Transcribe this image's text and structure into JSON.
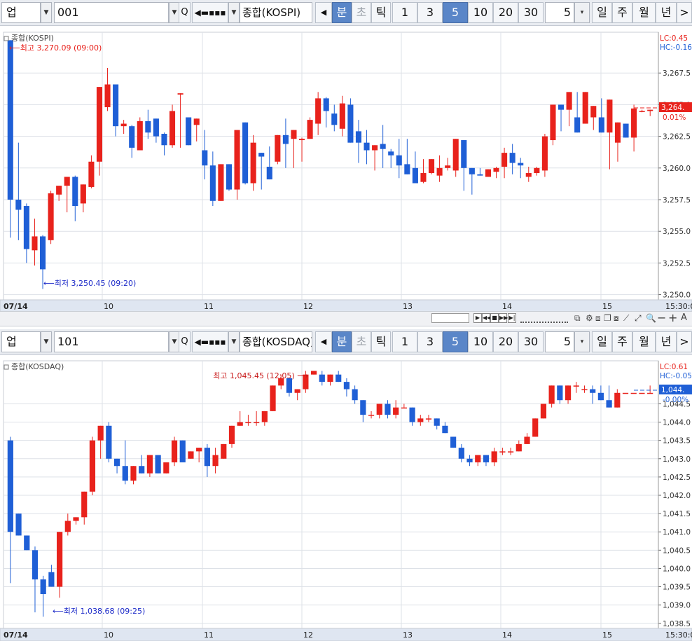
{
  "toolbar1": {
    "type_label": "업",
    "code": "001",
    "name": "종합(KOSPI)",
    "period_tabs": [
      "분",
      "초",
      "틱"
    ],
    "intervals": [
      "1",
      "3",
      "5",
      "10",
      "20",
      "30"
    ],
    "active_interval": "5",
    "count_value": "5",
    "range_tabs": [
      "일",
      "주",
      "월",
      "년"
    ]
  },
  "toolbar2": {
    "type_label": "업",
    "code": "101",
    "name": "종합(KOSDAQ)",
    "period_tabs": [
      "분",
      "초",
      "틱"
    ],
    "intervals": [
      "1",
      "3",
      "5",
      "10",
      "20",
      "30"
    ],
    "active_interval": "5",
    "count_value": "5",
    "range_tabs": [
      "일",
      "주",
      "월",
      "년"
    ]
  },
  "chart1": {
    "title": "종합(KOSPI)",
    "high_label": "최고 3,270.09 (09:00)",
    "low_label": "최저 3,250.45 (09:20)",
    "lc_label": "LC:0.45",
    "hc_label": "HC:-0.16",
    "current_price": "3,264.",
    "current_change": "0.01%"
  },
  "chart2": {
    "title": "종합(KOSDAQ)",
    "high_label": "최고 1,045.45 (12:05)",
    "low_label": "최저 1,038.68 (09:25)",
    "lc_label": "LC:0.61",
    "hc_label": "HC:-0.05",
    "current_price": "1,044.",
    "current_change": "-0.00%"
  },
  "colors": {
    "up": "#e8221c",
    "down": "#1f5fd6",
    "grid": "#dde1e7",
    "axis_bg": "#dfe6f1"
  },
  "chart_data": [
    {
      "type": "candlestick",
      "title": "종합(KOSPI)",
      "x_ticks": [
        "07/14",
        "10",
        "11",
        "12",
        "13",
        "14",
        "15",
        "15:30:0"
      ],
      "y_ticks": [
        "3,267.5",
        "3,265.0",
        "3,262.5",
        "3,260.0",
        "3,257.5",
        "3,255.0",
        "3,252.5",
        "3,250.0"
      ],
      "ylim": [
        3249.7,
        3270.5
      ],
      "candles": [
        [
          3270.09,
          3270.09,
          3254.5,
          3257.5
        ],
        [
          3257.5,
          3262.0,
          3254.3,
          3256.7
        ],
        [
          3257.0,
          3257.2,
          3252.5,
          3253.6
        ],
        [
          3253.5,
          3256.0,
          3252.3,
          3254.6
        ],
        [
          3254.6,
          3254.7,
          3250.45,
          3252.0
        ],
        [
          3254.3,
          3258.2,
          3254.0,
          3258.0
        ],
        [
          3257.9,
          3258.4,
          3257.4,
          3258.6
        ],
        [
          3258.6,
          3259.3,
          3256.5,
          3259.3
        ],
        [
          3259.3,
          3259.4,
          3255.8,
          3257.0
        ],
        [
          3257.2,
          3258.0,
          3256.5,
          3258.7
        ],
        [
          3258.5,
          3261.0,
          3258.4,
          3260.5
        ],
        [
          3260.5,
          3266.2,
          3259.4,
          3266.4
        ],
        [
          3264.8,
          3267.9,
          3264.5,
          3266.6
        ],
        [
          3266.6,
          3263.0,
          3262.5,
          3263.3
        ],
        [
          3263.3,
          3263.8,
          3262.7,
          3263.5
        ],
        [
          3263.3,
          3263.4,
          3260.8,
          3261.6
        ],
        [
          3261.4,
          3264.0,
          3261.4,
          3263.7
        ],
        [
          3263.7,
          3264.6,
          3262.3,
          3262.8
        ],
        [
          3263.9,
          3262.6,
          3262.0,
          3262.5
        ],
        [
          3262.7,
          3262.8,
          3261.0,
          3261.8
        ],
        [
          3261.8,
          3265.0,
          3261.6,
          3264.5
        ],
        [
          3265.8,
          3265.9,
          3261.6,
          3265.9
        ],
        [
          3264.0,
          3262.0,
          3262.0,
          3261.8
        ],
        [
          3263.4,
          3263.4,
          3262.1,
          3263.9
        ],
        [
          3261.4,
          3263.0,
          3259.1,
          3260.2
        ],
        [
          3260.2,
          3261.3,
          3257.0,
          3257.4
        ],
        [
          3257.4,
          3257.4,
          3259.7,
          3260.3
        ],
        [
          3260.3,
          3260.3,
          3258.2,
          3258.3
        ],
        [
          3258.3,
          3263.0,
          3257.5,
          3263.0
        ],
        [
          3263.6,
          3263.6,
          3258.7,
          3258.8
        ],
        [
          3258.8,
          3262.6,
          3258.2,
          3262.0
        ],
        [
          3261.2,
          3260.9,
          3258.3,
          3260.9
        ],
        [
          3260.1,
          3261.7,
          3259.1,
          3259.1
        ],
        [
          3260.5,
          3262.3,
          3260.3,
          3262.6
        ],
        [
          3262.6,
          3263.9,
          3260.0,
          3261.9
        ],
        [
          3262.3,
          3263.0,
          3260.0,
          3263.0
        ],
        [
          3262.2,
          3262.4,
          3260.5,
          3262.3
        ],
        [
          3262.3,
          3264.0,
          3263.1,
          3263.8
        ],
        [
          3263.5,
          3266.0,
          3262.6,
          3265.5
        ],
        [
          3265.5,
          3265.6,
          3263.2,
          3264.5
        ],
        [
          3264.3,
          3265.0,
          3262.9,
          3263.4
        ],
        [
          3263.1,
          3265.7,
          3262.5,
          3265.1
        ],
        [
          3265.0,
          3265.5,
          3262.8,
          3262.0
        ],
        [
          3262.9,
          3263.8,
          3260.4,
          3262.0
        ],
        [
          3262.0,
          3263.0,
          3260.3,
          3261.4
        ],
        [
          3261.4,
          3261.0,
          3259.8,
          3261.8
        ],
        [
          3261.9,
          3263.4,
          3260.0,
          3261.5
        ],
        [
          3261.3,
          3261.5,
          3260.0,
          3261.0
        ],
        [
          3261.0,
          3262.3,
          3259.2,
          3260.2
        ],
        [
          3260.3,
          3262.3,
          3260.0,
          3259.5
        ],
        [
          3260.0,
          3261.3,
          3258.9,
          3258.8
        ],
        [
          3258.9,
          3260.7,
          3258.8,
          3259.6
        ],
        [
          3259.6,
          3260.3,
          3259.5,
          3260.7
        ],
        [
          3259.4,
          3261.0,
          3258.9,
          3260.0
        ],
        [
          3260.0,
          3260.8,
          3259.8,
          3260.2
        ],
        [
          3259.8,
          3262.2,
          3259.3,
          3262.3
        ],
        [
          3262.2,
          3261.3,
          3258.2,
          3260.0
        ],
        [
          3260.0,
          3260.0,
          3257.9,
          3259.5
        ],
        [
          3259.5,
          3260.0,
          3259.4,
          3259.4
        ],
        [
          3259.3,
          3259.8,
          3259.5,
          3259.9
        ],
        [
          3259.7,
          3260.1,
          3259.2,
          3260.0
        ],
        [
          3260.1,
          3261.6,
          3259.2,
          3261.2
        ],
        [
          3261.2,
          3261.9,
          3259.5,
          3260.4
        ],
        [
          3260.4,
          3260.8,
          3259.2,
          3260.2
        ],
        [
          3259.3,
          3260.1,
          3258.9,
          3259.6
        ],
        [
          3259.6,
          3260.1,
          3259.4,
          3260.0
        ],
        [
          3259.8,
          3262.7,
          3259.3,
          3262.5
        ],
        [
          3262.2,
          3262.3,
          3261.8,
          3265.0
        ],
        [
          3265.0,
          3265.0,
          3262.9,
          3264.6
        ],
        [
          3264.6,
          3265.3,
          3263.3,
          3266.0
        ],
        [
          3264.0,
          3266.0,
          3263.0,
          3262.8
        ],
        [
          3263.5,
          3265.1,
          3264.1,
          3266.0
        ],
        [
          3264.0,
          3264.0,
          3263.0,
          3264.9
        ],
        [
          3264.0,
          3265.5,
          3262.8,
          3262.8
        ],
        [
          3262.8,
          3264.6,
          3259.9,
          3265.4
        ],
        [
          3262.0,
          3263.6,
          3260.5,
          3263.6
        ],
        [
          3263.5,
          3262.9,
          3263.0,
          3262.4
        ],
        [
          3262.4,
          3265.0,
          3261.3,
          3264.7
        ],
        [
          3264.5,
          3264.6,
          3264.4,
          3264.5
        ],
        [
          3264.5,
          3264.6,
          3264.1,
          3264.6
        ]
      ]
    },
    {
      "type": "candlestick",
      "title": "종합(KOSDAQ)",
      "x_ticks": [
        "07/14",
        "10",
        "11",
        "12",
        "13",
        "14",
        "15",
        "15:30:0"
      ],
      "y_ticks": [
        "1,044.5",
        "1,044.0",
        "1,043.5",
        "1,043.0",
        "1,042.5",
        "1,042.0",
        "1,041.5",
        "1,041.0",
        "1,040.5",
        "1,040.0",
        "1,039.5",
        "1,039.0",
        "1,038.5"
      ],
      "ylim": [
        1038.4,
        1045.6
      ],
      "candles": [
        [
          1043.5,
          1043.6,
          1039.6,
          1041.0
        ],
        [
          1041.5,
          1041.5,
          1041.7,
          1040.9
        ],
        [
          1040.9,
          1040.9,
          1040.7,
          1040.5
        ],
        [
          1040.5,
          1040.6,
          1038.8,
          1039.7
        ],
        [
          1039.7,
          1039.8,
          1038.68,
          1039.3
        ],
        [
          1039.9,
          1040.1,
          1039.9,
          1039.5
        ],
        [
          1039.5,
          1041.0,
          1039.2,
          1041.0
        ],
        [
          1041.0,
          1041.5,
          1040.9,
          1041.3
        ],
        [
          1041.3,
          1041.4,
          1041.2,
          1041.4
        ],
        [
          1041.4,
          1042.1,
          1041.2,
          1042.1
        ],
        [
          1042.1,
          1043.6,
          1042.0,
          1043.5
        ],
        [
          1043.5,
          1043.9,
          1043.0,
          1043.9
        ],
        [
          1043.9,
          1044.0,
          1042.9,
          1043.0
        ],
        [
          1043.0,
          1043.0,
          1042.6,
          1042.8
        ],
        [
          1042.8,
          1043.5,
          1042.3,
          1042.4
        ],
        [
          1042.4,
          1042.8,
          1042.3,
          1042.8
        ],
        [
          1042.8,
          1043.1,
          1042.6,
          1042.6
        ],
        [
          1042.6,
          1043.1,
          1042.5,
          1043.1
        ],
        [
          1043.1,
          1043.1,
          1042.6,
          1042.6
        ],
        [
          1042.6,
          1042.6,
          1042.6,
          1042.9
        ],
        [
          1042.9,
          1043.6,
          1042.8,
          1043.5
        ],
        [
          1043.5,
          1043.5,
          1042.9,
          1042.9
        ],
        [
          1043.0,
          1043.2,
          1043.0,
          1043.2
        ],
        [
          1043.2,
          1043.3,
          1042.9,
          1043.3
        ],
        [
          1043.3,
          1043.4,
          1042.5,
          1042.8
        ],
        [
          1042.8,
          1043.3,
          1042.6,
          1043.1
        ],
        [
          1043.0,
          1043.4,
          1043.0,
          1043.4
        ],
        [
          1043.4,
          1043.9,
          1043.3,
          1043.9
        ],
        [
          1043.9,
          1044.3,
          1043.9,
          1044.0
        ],
        [
          1044.0,
          1044.2,
          1043.9,
          1044.0
        ],
        [
          1044.0,
          1044.3,
          1043.9,
          1044.0
        ],
        [
          1044.0,
          1044.3,
          1043.9,
          1044.3
        ],
        [
          1044.3,
          1045.0,
          1044.3,
          1045.0
        ],
        [
          1045.0,
          1045.3,
          1044.9,
          1045.2
        ],
        [
          1045.2,
          1045.2,
          1044.7,
          1044.8
        ],
        [
          1044.8,
          1044.9,
          1044.6,
          1044.9
        ],
        [
          1044.9,
          1045.4,
          1044.8,
          1045.3
        ],
        [
          1045.3,
          1045.4,
          1045.3,
          1045.4
        ],
        [
          1045.3,
          1045.4,
          1045.0,
          1045.1
        ],
        [
          1045.1,
          1045.3,
          1045.0,
          1045.3
        ],
        [
          1045.3,
          1045.4,
          1045.1,
          1045.1
        ],
        [
          1045.1,
          1045.2,
          1044.7,
          1044.9
        ],
        [
          1044.9,
          1045.0,
          1044.5,
          1044.6
        ],
        [
          1044.6,
          1044.6,
          1044.0,
          1044.2
        ],
        [
          1044.2,
          1044.3,
          1044.1,
          1044.2
        ],
        [
          1044.2,
          1044.5,
          1044.1,
          1044.5
        ],
        [
          1044.5,
          1044.6,
          1044.1,
          1044.2
        ],
        [
          1044.2,
          1044.6,
          1044.1,
          1044.4
        ],
        [
          1044.4,
          1044.5,
          1044.4,
          1044.4
        ],
        [
          1044.4,
          1044.4,
          1043.9,
          1044.0
        ],
        [
          1044.0,
          1044.2,
          1043.9,
          1044.1
        ],
        [
          1044.1,
          1044.2,
          1044.0,
          1044.1
        ],
        [
          1044.1,
          1044.1,
          1043.8,
          1043.9
        ],
        [
          1043.9,
          1044.0,
          1043.7,
          1043.7
        ],
        [
          1043.6,
          1043.6,
          1043.3,
          1043.3
        ],
        [
          1043.3,
          1043.4,
          1042.9,
          1043.0
        ],
        [
          1043.0,
          1043.1,
          1042.8,
          1042.9
        ],
        [
          1042.9,
          1043.1,
          1042.8,
          1043.1
        ],
        [
          1043.1,
          1043.1,
          1042.8,
          1042.9
        ],
        [
          1042.9,
          1043.3,
          1042.8,
          1043.2
        ],
        [
          1043.2,
          1043.3,
          1043.1,
          1043.2
        ],
        [
          1043.2,
          1043.3,
          1043.1,
          1043.2
        ],
        [
          1043.2,
          1043.5,
          1043.2,
          1043.4
        ],
        [
          1043.4,
          1043.7,
          1043.4,
          1043.6
        ],
        [
          1043.6,
          1044.1,
          1043.6,
          1044.1
        ],
        [
          1044.1,
          1044.5,
          1044.1,
          1044.5
        ],
        [
          1044.5,
          1045.0,
          1044.4,
          1045.0
        ],
        [
          1045.0,
          1045.0,
          1044.5,
          1044.6
        ],
        [
          1044.6,
          1045.0,
          1044.5,
          1045.0
        ],
        [
          1045.0,
          1045.1,
          1044.8,
          1045.0
        ],
        [
          1044.9,
          1045.0,
          1044.8,
          1044.9
        ],
        [
          1044.9,
          1045.0,
          1044.5,
          1044.8
        ],
        [
          1044.8,
          1045.0,
          1044.7,
          1044.6
        ],
        [
          1044.6,
          1045.0,
          1044.5,
          1044.4
        ],
        [
          1044.4,
          1044.9,
          1044.4,
          1044.8
        ],
        [
          1044.8,
          1044.8,
          1044.8,
          1044.8
        ],
        [
          1044.8,
          1044.8,
          1044.8,
          1044.8
        ],
        [
          1044.8,
          1044.8,
          1044.8,
          1044.8
        ],
        [
          1044.8,
          1045.0,
          1044.8,
          1044.8
        ]
      ]
    }
  ]
}
